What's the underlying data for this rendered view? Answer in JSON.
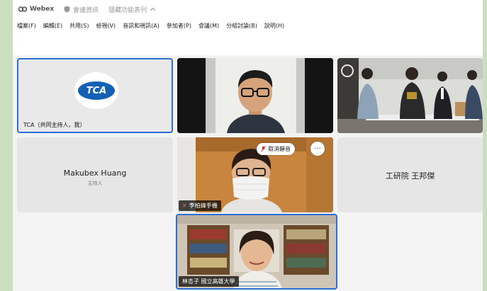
{
  "app": {
    "name": "Webex",
    "meeting_info": "會議資訊",
    "hide_toolbar": "隱藏功能表列"
  },
  "menu": [
    "檔案(F)",
    "編輯(E)",
    "共用(S)",
    "檢視(V)",
    "音訊和視訊(A)",
    "參加者(P)",
    "會議(M)",
    "分組討論(B)",
    "說明(H)"
  ],
  "tiles": {
    "tca": {
      "logo_text": "TCA",
      "name": "TCA（共同主持人，我）"
    },
    "makubex": {
      "name": "Makubex Huang",
      "role": "主持人"
    },
    "itri": {
      "name": "工研院 王邦傑"
    },
    "lee": {
      "name": "李柏緯手機",
      "unmute_label": "取消靜音",
      "more": "···"
    },
    "lin": {
      "name": "林杏子 國立高雄大學"
    }
  },
  "colors": {
    "accent": "#2b6fd6",
    "brand": "#1261b5",
    "mic_off": "#ff5b5b"
  }
}
